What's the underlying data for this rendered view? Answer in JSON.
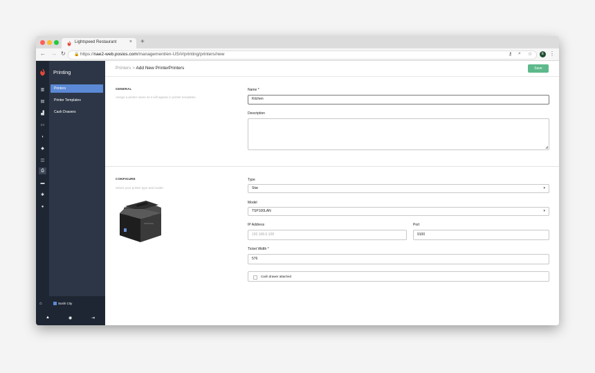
{
  "browser": {
    "tab_title": "Lightspeed Restaurant",
    "tab_close": "×",
    "new_tab": "+",
    "url_prefix": "https://",
    "url_host": "nae2-web.posios.com",
    "url_path": "/management/en-US/#/printing/printers/new",
    "profile_initial": "E"
  },
  "sidebar": {
    "title": "Printing",
    "items": [
      {
        "label": "Printers",
        "active": true
      },
      {
        "label": "Printer Templates",
        "active": false
      },
      {
        "label": "Cash Drawers",
        "active": false
      }
    ],
    "location": "Sushi City",
    "location_badge": "SC"
  },
  "header": {
    "breadcrumb_parent": "Printers",
    "breadcrumb_sep": ">",
    "breadcrumb_current": "Add New PrinterPrinters",
    "save_label": "Save"
  },
  "general": {
    "title": "GENERAL",
    "description": "Assign a printer name as it will appear in printer templates.",
    "name_label": "Name *",
    "name_value": "Kitchen",
    "description_label": "Description",
    "description_value": ""
  },
  "configure": {
    "title": "CONFIGURE",
    "description": "Select your printer type and model.",
    "type_label": "Type",
    "type_value": "Star",
    "model_label": "Model",
    "model_value": "TSP100LAN",
    "ip_label": "IP Address",
    "ip_placeholder": "192.168.0.108",
    "port_label": "Port",
    "port_value": "9100",
    "ticket_width_label": "Ticket Width *",
    "ticket_width_value": "576",
    "cash_drawer_label": "Cash drawer attached",
    "cash_drawer_checked": false
  },
  "colors": {
    "accent_blue": "#5b89d6",
    "save_green": "#5db98b",
    "sidebar_bg": "#2c3646",
    "rail_bg": "#1e2633",
    "brand_red": "#e5483b"
  },
  "icons": {
    "dropdown": "▾",
    "resize": "◢"
  }
}
